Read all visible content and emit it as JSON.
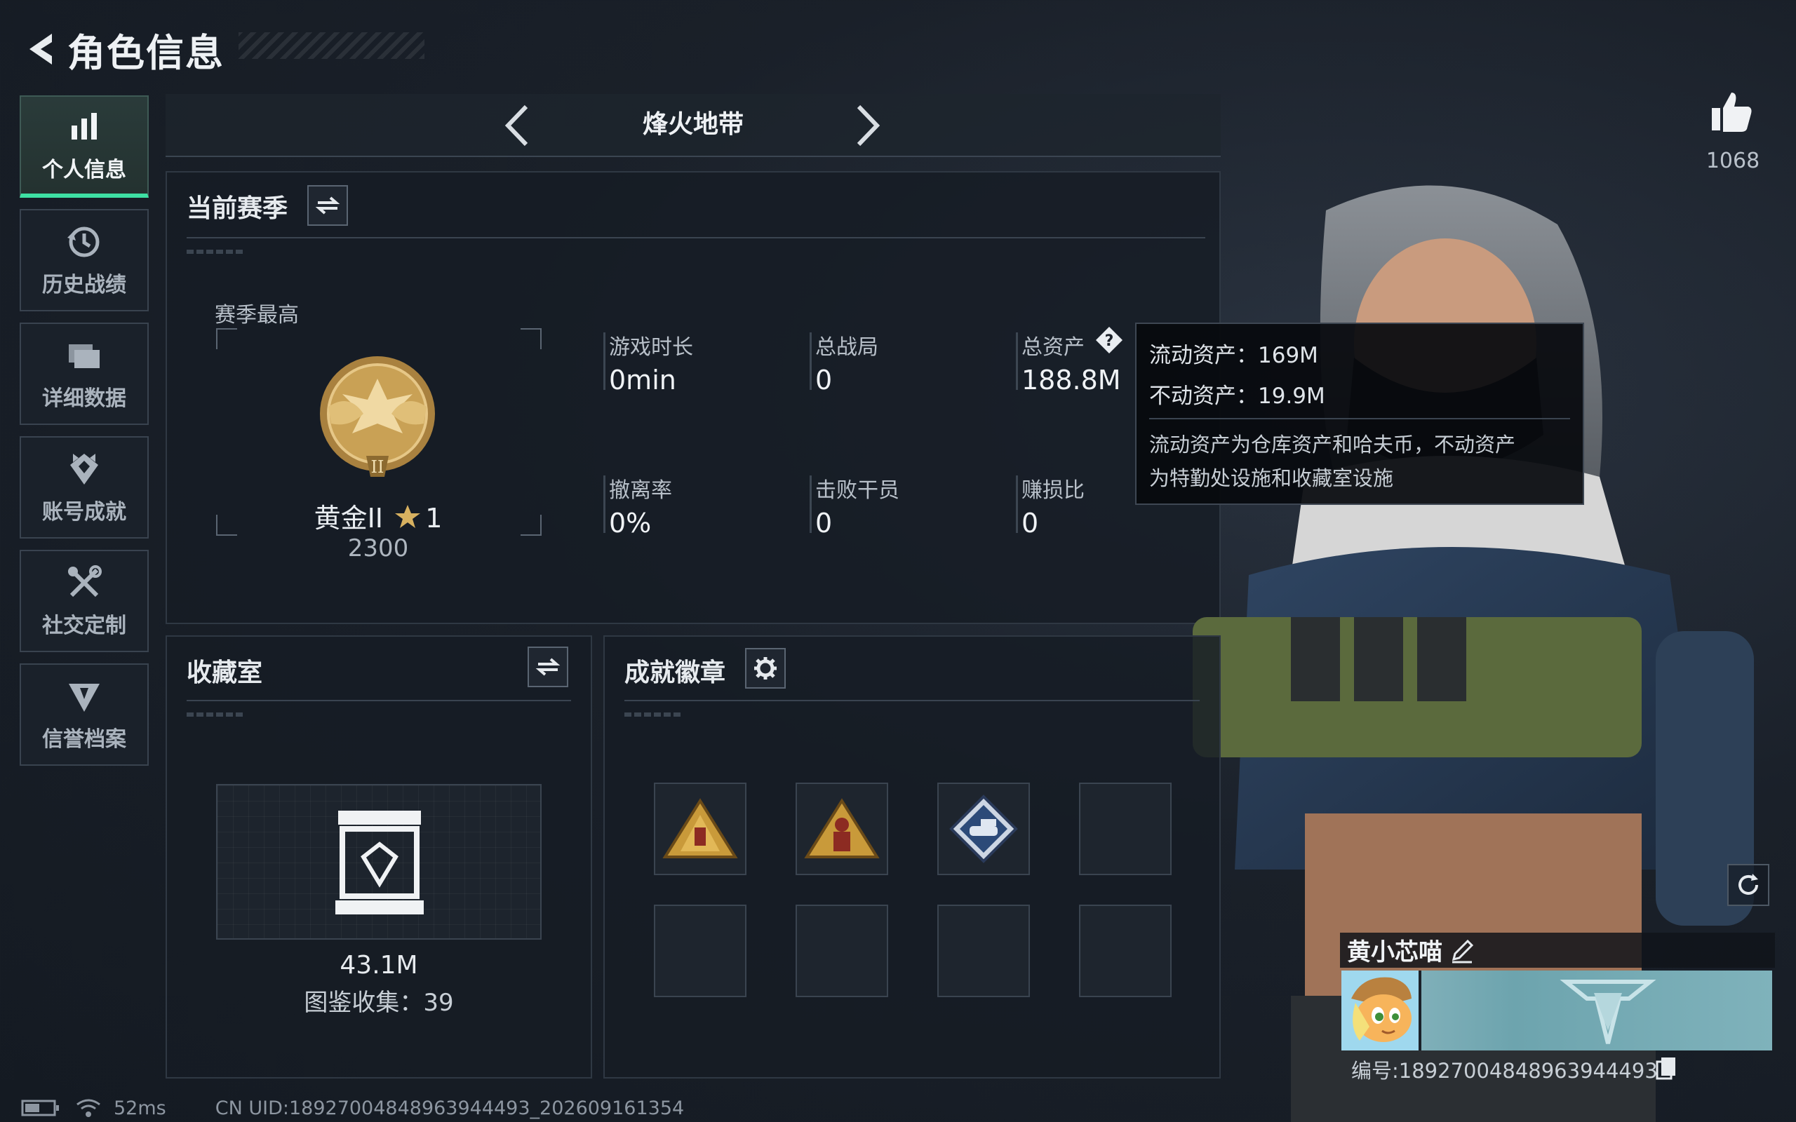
{
  "header": {
    "title": "角色信息"
  },
  "sidebar": {
    "items": [
      {
        "label": "个人信息",
        "icon": "bar-chart-icon",
        "active": true
      },
      {
        "label": "历史战绩",
        "icon": "history-clock-icon",
        "active": false
      },
      {
        "label": "详细数据",
        "icon": "folders-icon",
        "active": false
      },
      {
        "label": "账号成就",
        "icon": "achievement-medal-icon",
        "active": false
      },
      {
        "label": "社交定制",
        "icon": "tools-icon",
        "active": false
      },
      {
        "label": "信誉档案",
        "icon": "shield-badge-icon",
        "active": false
      }
    ]
  },
  "mode": {
    "title": "烽火地带"
  },
  "season": {
    "title": "当前赛季",
    "best_label": "赛季最高",
    "rank_name": "黄金II",
    "rank_stars": "1",
    "rank_score": "2300",
    "stats": [
      {
        "label": "游戏时长",
        "value": "0min"
      },
      {
        "label": "总战局",
        "value": "0"
      },
      {
        "label": "总资产",
        "value": "188.8M"
      },
      {
        "label": "撤离率",
        "value": "0%"
      },
      {
        "label": "击败干员",
        "value": "0"
      },
      {
        "label": "赚损比",
        "value": "0"
      }
    ]
  },
  "tooltip": {
    "liquid": "流动资产：169M",
    "fixed": "不动资产：19.9M",
    "desc_1": "流动资产为仓库资产和哈夫币，不动资产",
    "desc_2": "为特勤处设施和收藏室设施"
  },
  "collection": {
    "title": "收藏室",
    "value": "43.1M",
    "count": "图鉴收集：39"
  },
  "achievements": {
    "title": "成就徽章",
    "badges": [
      "badge-gold-pyramid",
      "badge-soldier-pyramid",
      "badge-blue-diamond-tank",
      "",
      "",
      "",
      "",
      ""
    ]
  },
  "likes": {
    "count": "1068"
  },
  "player": {
    "name": "黄小芯喵",
    "id": "编号:18927004848963944493"
  },
  "footer": {
    "ping": "52ms",
    "uid": "CN UID:18927004848963944493_202609161354"
  },
  "colors": {
    "accent": "#3ee0a3",
    "panel": "#161c24",
    "gold": "#c9a155"
  }
}
